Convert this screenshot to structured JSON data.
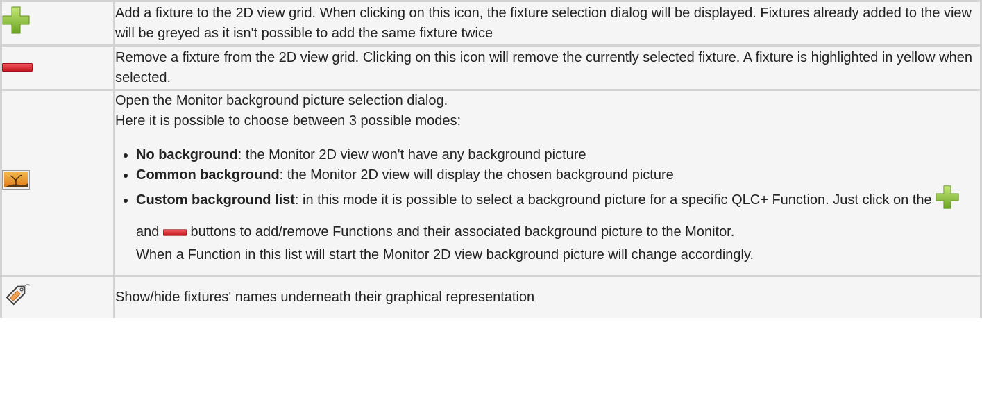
{
  "rows": [
    {
      "icon": "green-plus-icon",
      "text": "Add a fixture to the 2D view grid. When clicking on this icon, the fixture selection dialog will be displayed. Fixtures already added to the view will be greyed as it isn't possible to add the same fixture twice"
    },
    {
      "icon": "red-minus-icon",
      "text": "Remove a fixture from the 2D view grid. Clicking on this icon will remove the currently selected fixture. A fixture is highlighted in yellow when selected."
    },
    {
      "icon": "picture-icon",
      "line1": "Open the Monitor background picture selection dialog.",
      "line2": "Here it is possible to choose between 3 possible modes:",
      "modes": [
        {
          "name": "No background",
          "desc": ": the Monitor 2D view won't have any background picture"
        },
        {
          "name": "Common background",
          "desc": ": the Monitor 2D view will display the chosen background picture"
        },
        {
          "name": "Custom background list",
          "desc": ": in this mode it is possible to select a background picture for a specific QLC+ Function. Just click on the"
        }
      ],
      "and_word": "and",
      "buttons_text": "buttons to add/remove Functions and their associated background picture to the Monitor.",
      "change_text": "When a Function in this list will start the Monitor 2D view background picture will change accordingly."
    },
    {
      "icon": "tag-icon",
      "text": "Show/hide fixtures' names underneath their graphical representation"
    }
  ],
  "colors": {
    "plus_green": "#8cc63f",
    "minus_red": "#d32027",
    "border": "#d3d3d3",
    "cell_bg": "#f5f5f5"
  }
}
